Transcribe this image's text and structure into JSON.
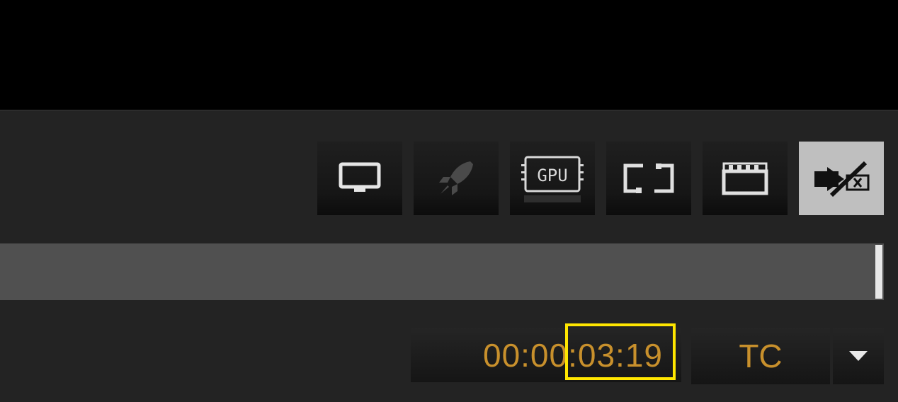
{
  "toolbar": {
    "buttons": [
      {
        "name": "monitor",
        "icon": "monitor-icon"
      },
      {
        "name": "rocket",
        "icon": "rocket-icon"
      },
      {
        "name": "gpu",
        "icon": "gpu-icon",
        "label": "GPU"
      },
      {
        "name": "loop",
        "icon": "loop-icon"
      },
      {
        "name": "clapper",
        "icon": "clapperboard-icon"
      },
      {
        "name": "export-disabled",
        "icon": "export-disabled-icon",
        "active": true
      }
    ]
  },
  "playback": {
    "position_fraction": 1.0
  },
  "timecode": {
    "value": "00:00:03:19",
    "mode": "TC"
  },
  "colors": {
    "timecode_text": "#c8902c",
    "highlight_box": "#ffe600",
    "active_button": "#bfbfbf"
  }
}
